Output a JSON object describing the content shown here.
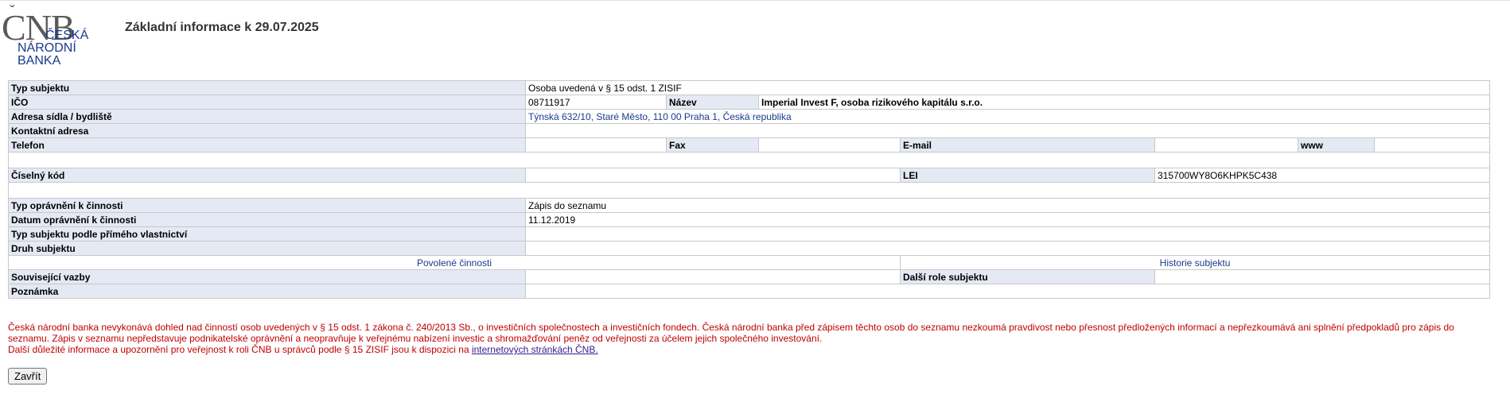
{
  "logo": {
    "mark": "CNB",
    "hacek": "ˇ",
    "line1": "ČESKÁ",
    "line2": "NÁRODNÍ",
    "line3": "BANKA"
  },
  "page_title": "Základní informace k 29.07.2025",
  "rows": {
    "typ_subjektu": {
      "label": "Typ subjektu",
      "value": "Osoba uvedená v § 15 odst. 1 ZISIF"
    },
    "ico": {
      "label": "IČO",
      "value": "08711917"
    },
    "nazev": {
      "label": "Název",
      "value": "Imperial Invest F, osoba rizikového kapitálu s.r.o."
    },
    "adresa": {
      "label": "Adresa sídla / bydliště",
      "value": "Týnská 632/10, Staré Město, 110 00 Praha 1, Česká republika"
    },
    "kontaktni_adresa": {
      "label": "Kontaktní adresa",
      "value": ""
    },
    "telefon": {
      "label": "Telefon",
      "value": ""
    },
    "fax": {
      "label": "Fax",
      "value": ""
    },
    "email": {
      "label": "E-mail",
      "value": ""
    },
    "www": {
      "label": "www",
      "value": ""
    },
    "ciselny_kod": {
      "label": "Číselný kód",
      "value": ""
    },
    "lei": {
      "label": "LEI",
      "value": "315700WY8O6KHPK5C438"
    },
    "typ_opravneni": {
      "label": "Typ oprávnění k činnosti",
      "value": "Zápis do seznamu"
    },
    "datum_opravneni": {
      "label": "Datum oprávnění k činnosti",
      "value": "11.12.2019"
    },
    "typ_vlastnictvi": {
      "label": "Typ subjektu podle přímého vlastnictví",
      "value": ""
    },
    "druh_subjektu": {
      "label": "Druh subjektu",
      "value": ""
    },
    "souvisejici_vazby": {
      "label": "Související vazby",
      "value": ""
    },
    "dalsi_role": {
      "label": "Další role subjektu",
      "value": ""
    },
    "poznamka": {
      "label": "Poznámka",
      "value": ""
    }
  },
  "links": {
    "povolene_cinnosti": "Povolené činnosti",
    "historie_subjektu": "Historie subjektu"
  },
  "disclaimer": {
    "para1": "Česká národní banka nevykonává dohled nad činností osob uvedených v § 15 odst. 1 zákona č. 240/2013 Sb., o investičních společnostech a investičních fondech. Česká národní banka před zápisem těchto osob do seznamu nezkoumá pravdivost nebo přesnost předložených informací a nepřezkoumává ani splnění předpokladů pro zápis do seznamu. Zápis v seznamu nepředstavuje podnikatelské oprávnění a neopravňuje k veřejnému nabízení investic a shromažďování peněz od veřejnosti za účelem jejich společného investování.",
    "para2_prefix": "Další důležité informace a upozornění pro veřejnost k roli ČNB u správců podle § 15 ZISIF jsou k dispozici na ",
    "para2_link": "internetových stránkách ČNB."
  },
  "buttons": {
    "close": "Zavřít"
  },
  "colors": {
    "label_bg": "#e4e9f4",
    "link_blue": "#1a3a8c",
    "disclaimer_red": "#c00000"
  }
}
